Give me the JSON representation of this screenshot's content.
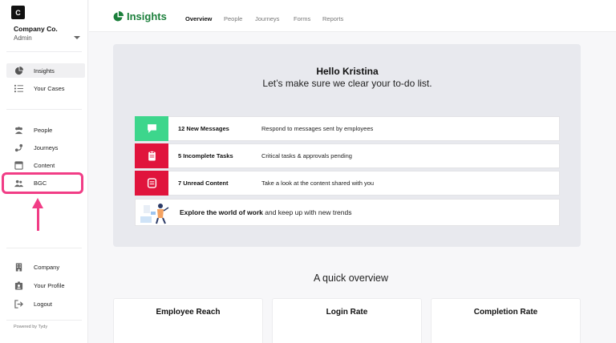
{
  "sidebar": {
    "logo_letter": "C",
    "company_name": "Company Co.",
    "role": "Admin",
    "items_primary": [
      {
        "label": "Insights",
        "icon": "pie-chart-icon"
      },
      {
        "label": "Your Cases",
        "icon": "checklist-icon"
      }
    ],
    "items_secondary": [
      {
        "label": "People",
        "icon": "people-icon"
      },
      {
        "label": "Journeys",
        "icon": "journey-icon"
      },
      {
        "label": "Content",
        "icon": "content-icon"
      },
      {
        "label": "BGC",
        "icon": "bgc-icon"
      }
    ],
    "items_bottom": [
      {
        "label": "Company",
        "icon": "building-icon"
      },
      {
        "label": "Your Profile",
        "icon": "profile-icon"
      },
      {
        "label": "Logout",
        "icon": "logout-icon"
      }
    ],
    "powered_by": "Powered by Tydy"
  },
  "topbar": {
    "brand": "Insights",
    "tabs": [
      {
        "label": "Overview",
        "active": true
      },
      {
        "label": "People"
      },
      {
        "label": "Journeys"
      },
      {
        "label": "Forms"
      },
      {
        "label": "Reports"
      }
    ]
  },
  "hero": {
    "greeting": "Hello Kristina",
    "subtitle": "Let’s make sure we clear your to-do list.",
    "tasks": [
      {
        "title": "12 New Messages",
        "description": "Respond to messages sent by employees",
        "color": "#3dd68c",
        "icon": "message-icon"
      },
      {
        "title": "5 Incomplete Tasks",
        "description": "Critical tasks & approvals pending",
        "color": "#e0143c",
        "icon": "clipboard-icon"
      },
      {
        "title": "7 Unread Content",
        "description": "Take a look at the content shared with you",
        "color": "#e0143c",
        "icon": "document-icon"
      }
    ],
    "explore_bold": "Explore the world of work",
    "explore_rest": " and keep up with new trends"
  },
  "overview": {
    "title": "A quick overview",
    "cards": [
      "Employee Reach",
      "Login Rate",
      "Completion Rate"
    ]
  },
  "colors": {
    "brand_green": "#1b7f3b",
    "highlight_pink": "#f13d86",
    "message_green": "#3dd68c",
    "alert_red": "#e0143c"
  }
}
